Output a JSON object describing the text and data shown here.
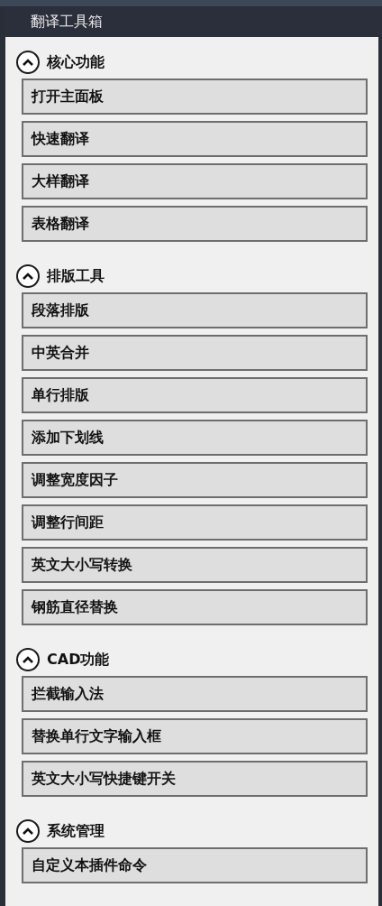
{
  "window": {
    "title": "翻译工具箱"
  },
  "sections": [
    {
      "title": "核心功能",
      "expanded": true,
      "buttons": [
        "打开主面板",
        "快速翻译",
        "大样翻译",
        "表格翻译"
      ]
    },
    {
      "title": "排版工具",
      "expanded": true,
      "buttons": [
        "段落排版",
        "中英合并",
        "单行排版",
        "添加下划线",
        "调整宽度因子",
        "调整行间距",
        "英文大小写转换",
        "钢筋直径替换"
      ]
    },
    {
      "title": "CAD功能",
      "expanded": true,
      "buttons": [
        "拦截输入法",
        "替换单行文字输入框",
        "英文大小写快捷键开关"
      ]
    },
    {
      "title": "系统管理",
      "expanded": true,
      "buttons": [
        "自定义本插件命令"
      ]
    }
  ]
}
